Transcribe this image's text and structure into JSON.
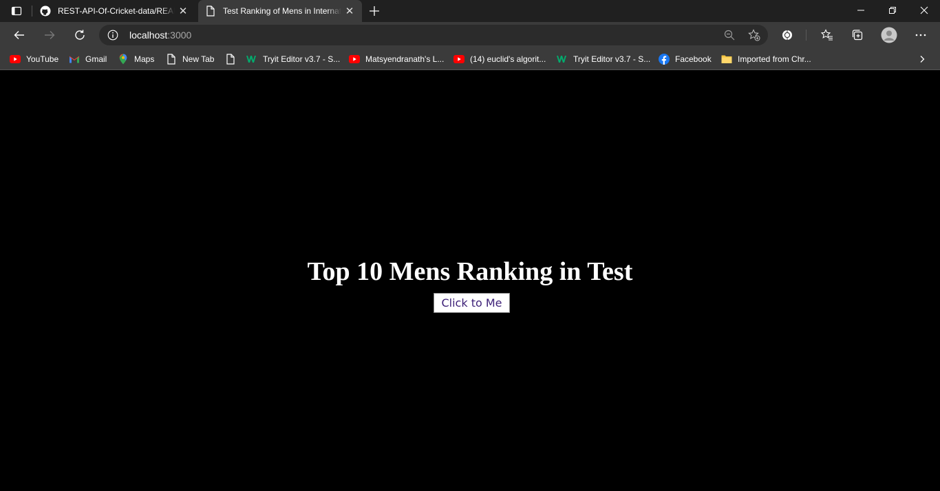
{
  "browser": {
    "tabs": [
      {
        "title": "REST-API-Of-Cricket-data/README",
        "icon": "github-icon",
        "active": false
      },
      {
        "title": "Test Ranking of Mens in International",
        "icon": "page-icon",
        "active": true
      }
    ],
    "address": {
      "host": "localhost",
      "port": ":3000"
    },
    "bookmarks": [
      {
        "label": "YouTube",
        "icon": "youtube-icon"
      },
      {
        "label": "Gmail",
        "icon": "gmail-icon"
      },
      {
        "label": "Maps",
        "icon": "maps-icon"
      },
      {
        "label": "New Tab",
        "icon": "page-icon"
      },
      {
        "label": "",
        "icon": "page-icon"
      },
      {
        "label": "Tryit Editor v3.7 - S...",
        "icon": "w3schools-icon"
      },
      {
        "label": "Matsyendranath's L...",
        "icon": "youtube-icon"
      },
      {
        "label": "(14) euclid's algorit...",
        "icon": "youtube-icon"
      },
      {
        "label": "Tryit Editor v3.7 - S...",
        "icon": "w3schools-icon"
      },
      {
        "label": "Facebook",
        "icon": "facebook-icon"
      },
      {
        "label": "Imported from Chr...",
        "icon": "folder-icon"
      }
    ],
    "colors": {
      "chrome_dark": "#202020",
      "chrome": "#3b3b3b",
      "accent_youtube": "#ff0000",
      "accent_facebook": "#1877f2",
      "folder": "#f4c542"
    }
  },
  "page": {
    "heading": "Top 10 Mens Ranking in Test",
    "button_label": "Click to Me",
    "background": "#000000"
  }
}
